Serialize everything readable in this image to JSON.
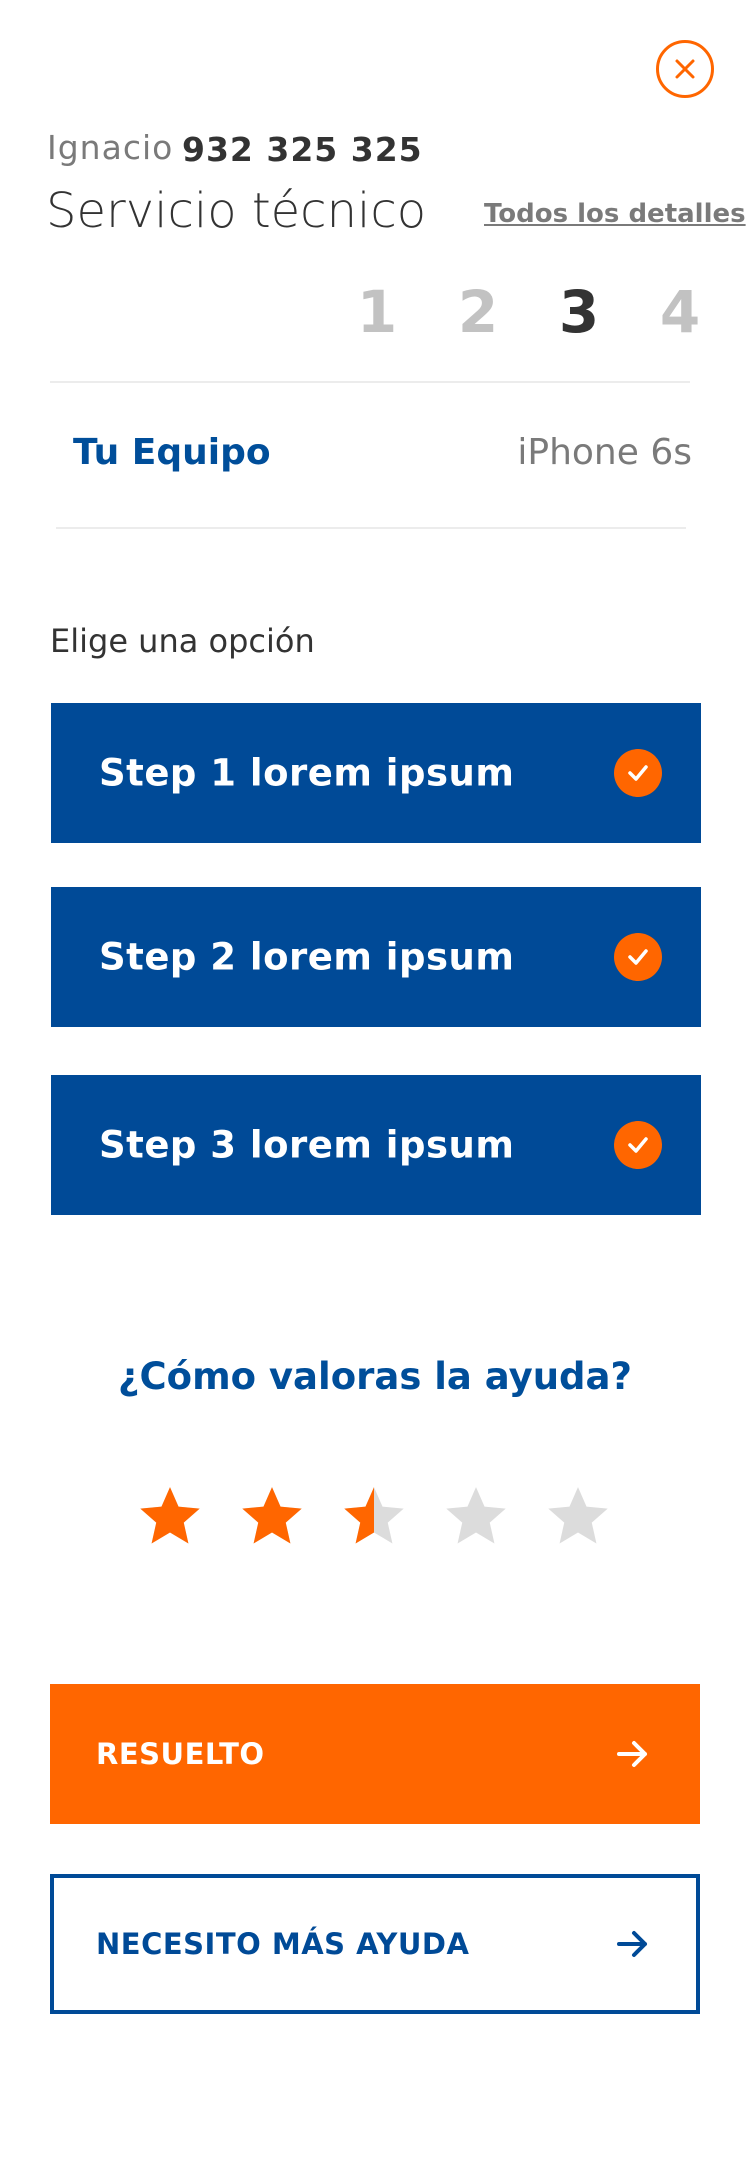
{
  "header": {
    "user_name": "Ignacio",
    "user_phone": "932 325 325",
    "title": "Servicio técnico",
    "details_link": "Todos los detalles",
    "close_icon": "close-icon"
  },
  "steps": {
    "items": [
      "1",
      "2",
      "3",
      "4"
    ],
    "current": "3"
  },
  "equipment": {
    "label": "Tu Equipo",
    "value": "iPhone 6s"
  },
  "options": {
    "heading": "Elige una opción",
    "items": [
      {
        "label": "Step 1 lorem ipsum",
        "checked": true
      },
      {
        "label": "Step 2 lorem ipsum",
        "checked": true
      },
      {
        "label": "Step 3 lorem ipsum",
        "checked": true
      }
    ]
  },
  "rating": {
    "question": "¿Cómo valoras la ayuda?",
    "value": 2.5,
    "max": 5
  },
  "actions": {
    "resolved": "RESUELTO",
    "need_help": "NECESITO MÁS AYUDA"
  },
  "colors": {
    "brand_blue": "#004a97",
    "accent_orange": "#ff6600",
    "star_empty": "#dcdcdc",
    "text_gray": "#7a7a7a"
  }
}
